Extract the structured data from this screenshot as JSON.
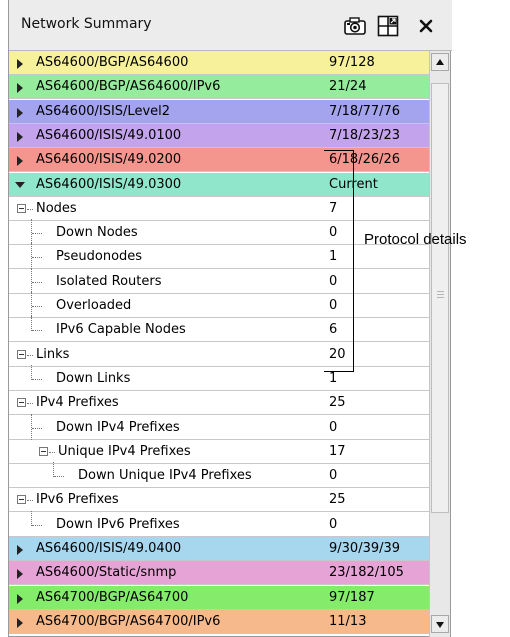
{
  "window": {
    "title": "Network Summary"
  },
  "icons": {
    "camera": "camera-icon",
    "detach": "detach-window-icon",
    "close": "close-icon"
  },
  "colors": {
    "yellow": "#f6f19a",
    "green": "#94ec9c",
    "blue": "#a3a3ee",
    "purple": "#c3a3ec",
    "red": "#f4968e",
    "teal": "#8fe6cb",
    "lightblue": "#a7d6ef",
    "pink": "#e5a3d6",
    "greenstrong": "#84ec6a",
    "orange": "#f6b98b"
  },
  "rows": [
    {
      "label": "AS64600/BGP/AS64600",
      "value": "97/128"
    },
    {
      "label": "AS64600/BGP/AS64600/IPv6",
      "value": "21/24"
    },
    {
      "label": "AS64600/ISIS/Level2",
      "value": "7/18/77/76"
    },
    {
      "label": "AS64600/ISIS/49.0100",
      "value": "7/18/23/23"
    },
    {
      "label": "AS64600/ISIS/49.0200",
      "value": "6/18/26/26"
    },
    {
      "label": "AS64600/ISIS/49.0300",
      "value": "Current"
    },
    {
      "label": "Nodes",
      "value": "7"
    },
    {
      "label": "Down Nodes",
      "value": "0"
    },
    {
      "label": "Pseudonodes",
      "value": "1"
    },
    {
      "label": "Isolated Routers",
      "value": "0"
    },
    {
      "label": "Overloaded",
      "value": "0"
    },
    {
      "label": "IPv6 Capable Nodes",
      "value": "6"
    },
    {
      "label": "Links",
      "value": "20"
    },
    {
      "label": "Down Links",
      "value": "1"
    },
    {
      "label": "IPv4 Prefixes",
      "value": "25"
    },
    {
      "label": "Down IPv4 Prefixes",
      "value": "0"
    },
    {
      "label": "Unique IPv4 Prefixes",
      "value": "17"
    },
    {
      "label": "Down Unique IPv4 Prefixes",
      "value": "0"
    },
    {
      "label": "IPv6 Prefixes",
      "value": "25"
    },
    {
      "label": "Down IPv6 Prefixes",
      "value": "0"
    },
    {
      "label": "AS64600/ISIS/49.0400",
      "value": "9/30/39/39"
    },
    {
      "label": "AS64600/Static/snmp",
      "value": "23/182/105"
    },
    {
      "label": "AS64700/BGP/AS64700",
      "value": "97/187"
    },
    {
      "label": "AS64700/BGP/AS64700/IPv6",
      "value": "11/13"
    }
  ],
  "annotation": {
    "text": "Protocol details"
  }
}
